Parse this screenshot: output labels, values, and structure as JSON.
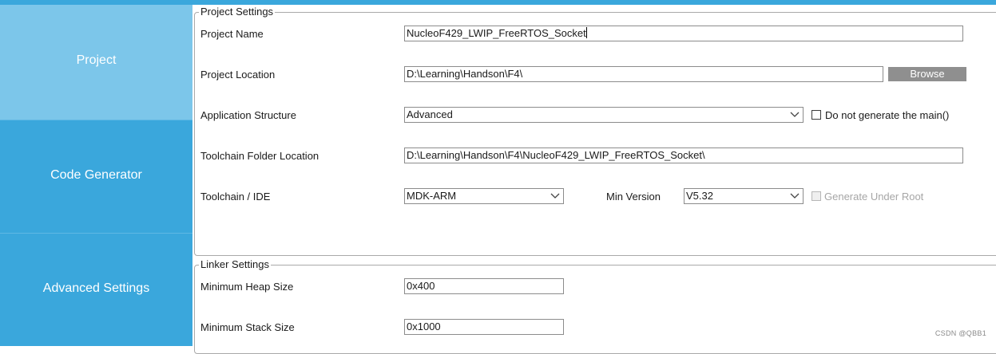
{
  "sidebar": {
    "items": [
      {
        "label": "Project"
      },
      {
        "label": "Code Generator"
      },
      {
        "label": "Advanced Settings"
      }
    ]
  },
  "project_settings": {
    "legend": "Project Settings",
    "project_name": {
      "label": "Project Name",
      "value": "NucleoF429_LWIP_FreeRTOS_Socket"
    },
    "project_location": {
      "label": "Project Location",
      "value": "D:\\Learning\\Handson\\F4\\",
      "browse_label": "Browse"
    },
    "application_structure": {
      "label": "Application Structure",
      "value": "Advanced",
      "checkbox_label": "Do not generate the main()",
      "checkbox_checked": false
    },
    "toolchain_folder": {
      "label": "Toolchain Folder Location",
      "value": "D:\\Learning\\Handson\\F4\\NucleoF429_LWIP_FreeRTOS_Socket\\"
    },
    "toolchain_ide": {
      "label": "Toolchain / IDE",
      "value": "MDK-ARM",
      "min_version_label": "Min Version",
      "min_version_value": "V5.32",
      "generate_root_label": "Generate Under Root",
      "generate_root_checked": false
    }
  },
  "linker_settings": {
    "legend": "Linker Settings",
    "heap": {
      "label": "Minimum Heap Size",
      "value": "0x400"
    },
    "stack": {
      "label": "Minimum Stack Size",
      "value": "0x1000"
    }
  },
  "watermark": "CSDN @QBB1",
  "colors": {
    "accent": "#3aa7dc",
    "active_nav": "#7cc6ea",
    "button": "#8f8f8f"
  }
}
